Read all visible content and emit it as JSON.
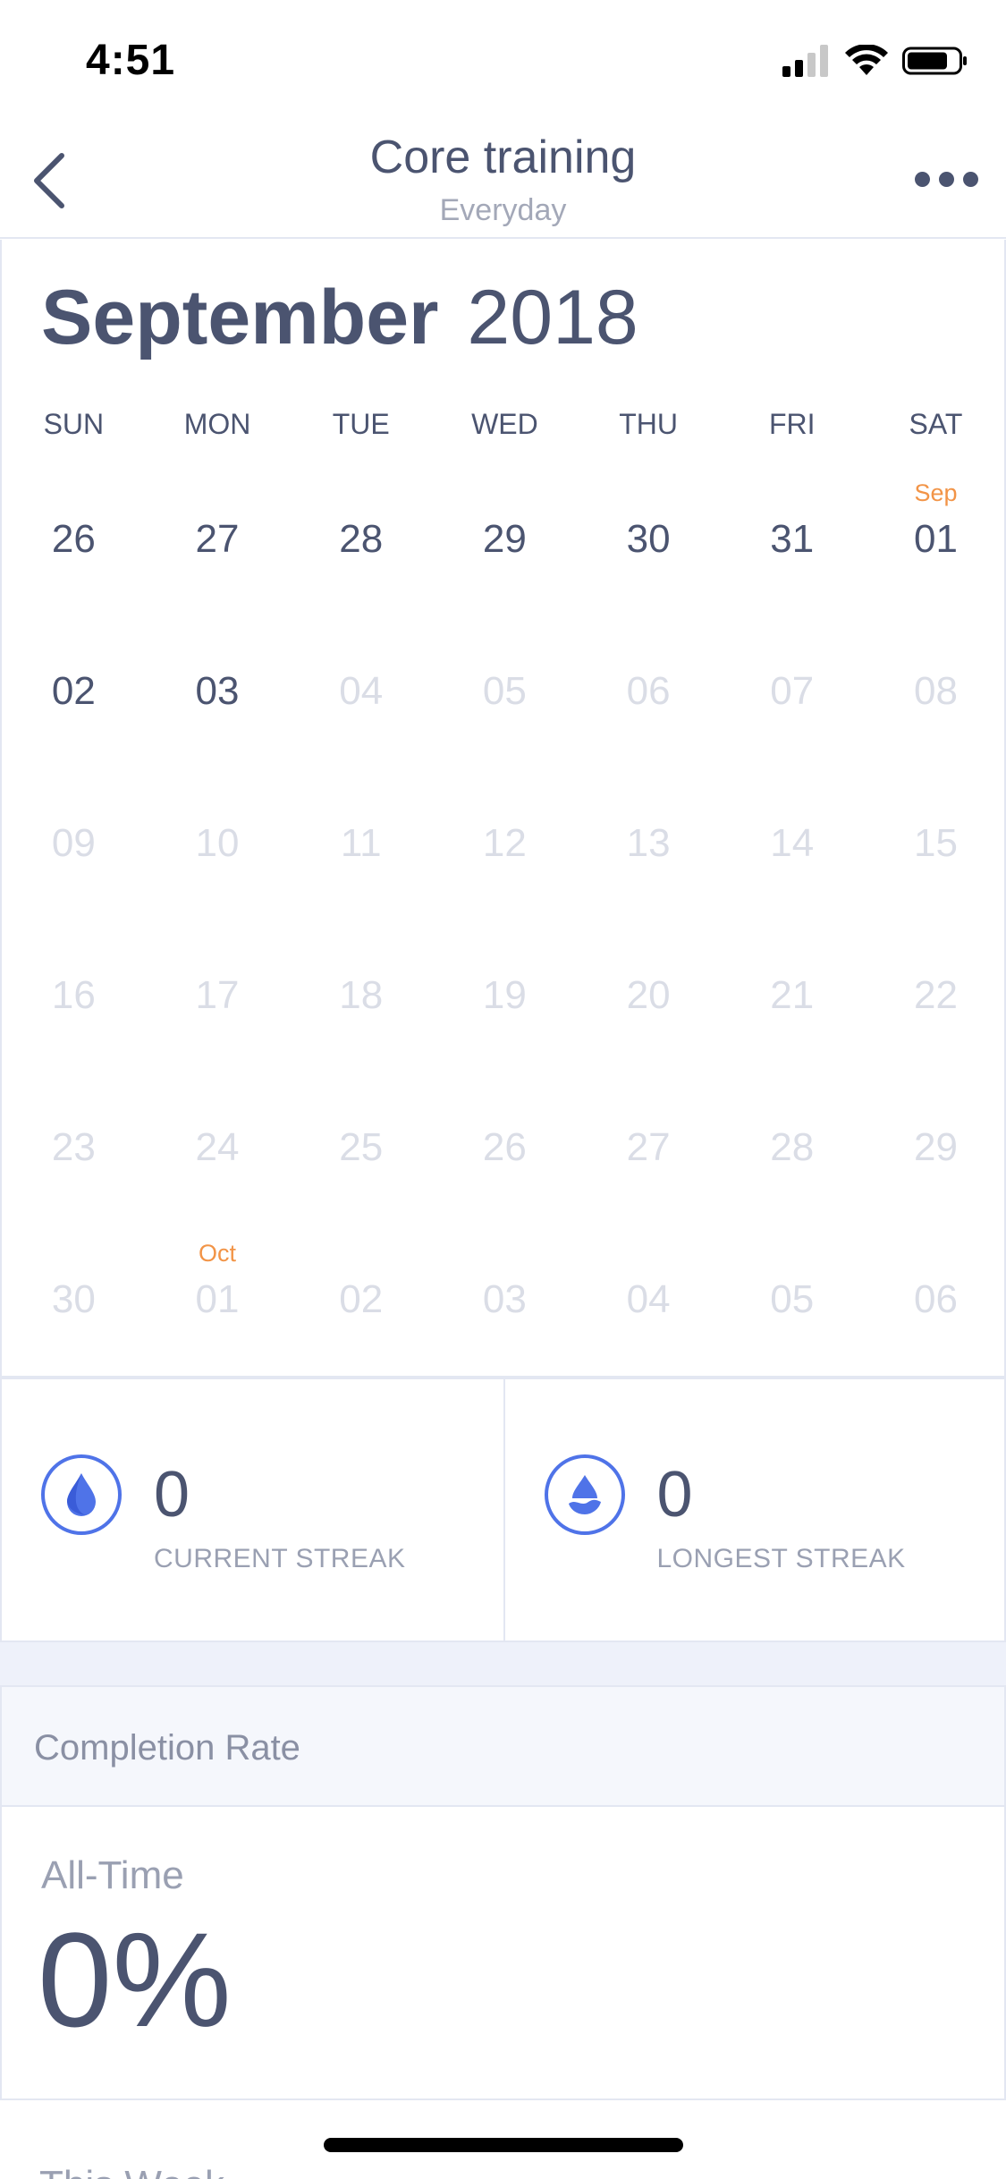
{
  "status_bar": {
    "time": "4:51"
  },
  "nav": {
    "title": "Core training",
    "subtitle": "Everyday"
  },
  "calendar": {
    "month": "September",
    "year": "2018",
    "weekdays": [
      "SUN",
      "MON",
      "TUE",
      "WED",
      "THU",
      "FRI",
      "SAT"
    ],
    "weeks": [
      [
        {
          "day": "26",
          "active": true,
          "marker": ""
        },
        {
          "day": "27",
          "active": true,
          "marker": ""
        },
        {
          "day": "28",
          "active": true,
          "marker": ""
        },
        {
          "day": "29",
          "active": true,
          "marker": ""
        },
        {
          "day": "30",
          "active": true,
          "marker": ""
        },
        {
          "day": "31",
          "active": true,
          "marker": ""
        },
        {
          "day": "01",
          "active": true,
          "marker": "Sep"
        }
      ],
      [
        {
          "day": "02",
          "active": true,
          "marker": ""
        },
        {
          "day": "03",
          "active": true,
          "marker": ""
        },
        {
          "day": "04",
          "active": false,
          "marker": ""
        },
        {
          "day": "05",
          "active": false,
          "marker": ""
        },
        {
          "day": "06",
          "active": false,
          "marker": ""
        },
        {
          "day": "07",
          "active": false,
          "marker": ""
        },
        {
          "day": "08",
          "active": false,
          "marker": ""
        }
      ],
      [
        {
          "day": "09",
          "active": false,
          "marker": ""
        },
        {
          "day": "10",
          "active": false,
          "marker": ""
        },
        {
          "day": "11",
          "active": false,
          "marker": ""
        },
        {
          "day": "12",
          "active": false,
          "marker": ""
        },
        {
          "day": "13",
          "active": false,
          "marker": ""
        },
        {
          "day": "14",
          "active": false,
          "marker": ""
        },
        {
          "day": "15",
          "active": false,
          "marker": ""
        }
      ],
      [
        {
          "day": "16",
          "active": false,
          "marker": ""
        },
        {
          "day": "17",
          "active": false,
          "marker": ""
        },
        {
          "day": "18",
          "active": false,
          "marker": ""
        },
        {
          "day": "19",
          "active": false,
          "marker": ""
        },
        {
          "day": "20",
          "active": false,
          "marker": ""
        },
        {
          "day": "21",
          "active": false,
          "marker": ""
        },
        {
          "day": "22",
          "active": false,
          "marker": ""
        }
      ],
      [
        {
          "day": "23",
          "active": false,
          "marker": ""
        },
        {
          "day": "24",
          "active": false,
          "marker": ""
        },
        {
          "day": "25",
          "active": false,
          "marker": ""
        },
        {
          "day": "26",
          "active": false,
          "marker": ""
        },
        {
          "day": "27",
          "active": false,
          "marker": ""
        },
        {
          "day": "28",
          "active": false,
          "marker": ""
        },
        {
          "day": "29",
          "active": false,
          "marker": ""
        }
      ],
      [
        {
          "day": "30",
          "active": false,
          "marker": ""
        },
        {
          "day": "01",
          "active": false,
          "marker": "Oct"
        },
        {
          "day": "02",
          "active": false,
          "marker": ""
        },
        {
          "day": "03",
          "active": false,
          "marker": ""
        },
        {
          "day": "04",
          "active": false,
          "marker": ""
        },
        {
          "day": "05",
          "active": false,
          "marker": ""
        },
        {
          "day": "06",
          "active": false,
          "marker": ""
        }
      ]
    ]
  },
  "streaks": {
    "current": {
      "value": "0",
      "label": "CURRENT STREAK",
      "icon": "drop-icon"
    },
    "longest": {
      "value": "0",
      "label": "LONGEST STREAK",
      "icon": "drop-wave-icon"
    }
  },
  "completion": {
    "header": "Completion Rate",
    "all_time_label": "All-Time",
    "all_time_value": "0%",
    "this_week_label": "This Week"
  },
  "colors": {
    "text_primary": "#4b5470",
    "text_muted": "#9aa0b2",
    "day_inactive": "#dadde6",
    "accent_orange": "#f29447",
    "accent_blue": "#4f73e8",
    "border": "#e3e7f2"
  }
}
